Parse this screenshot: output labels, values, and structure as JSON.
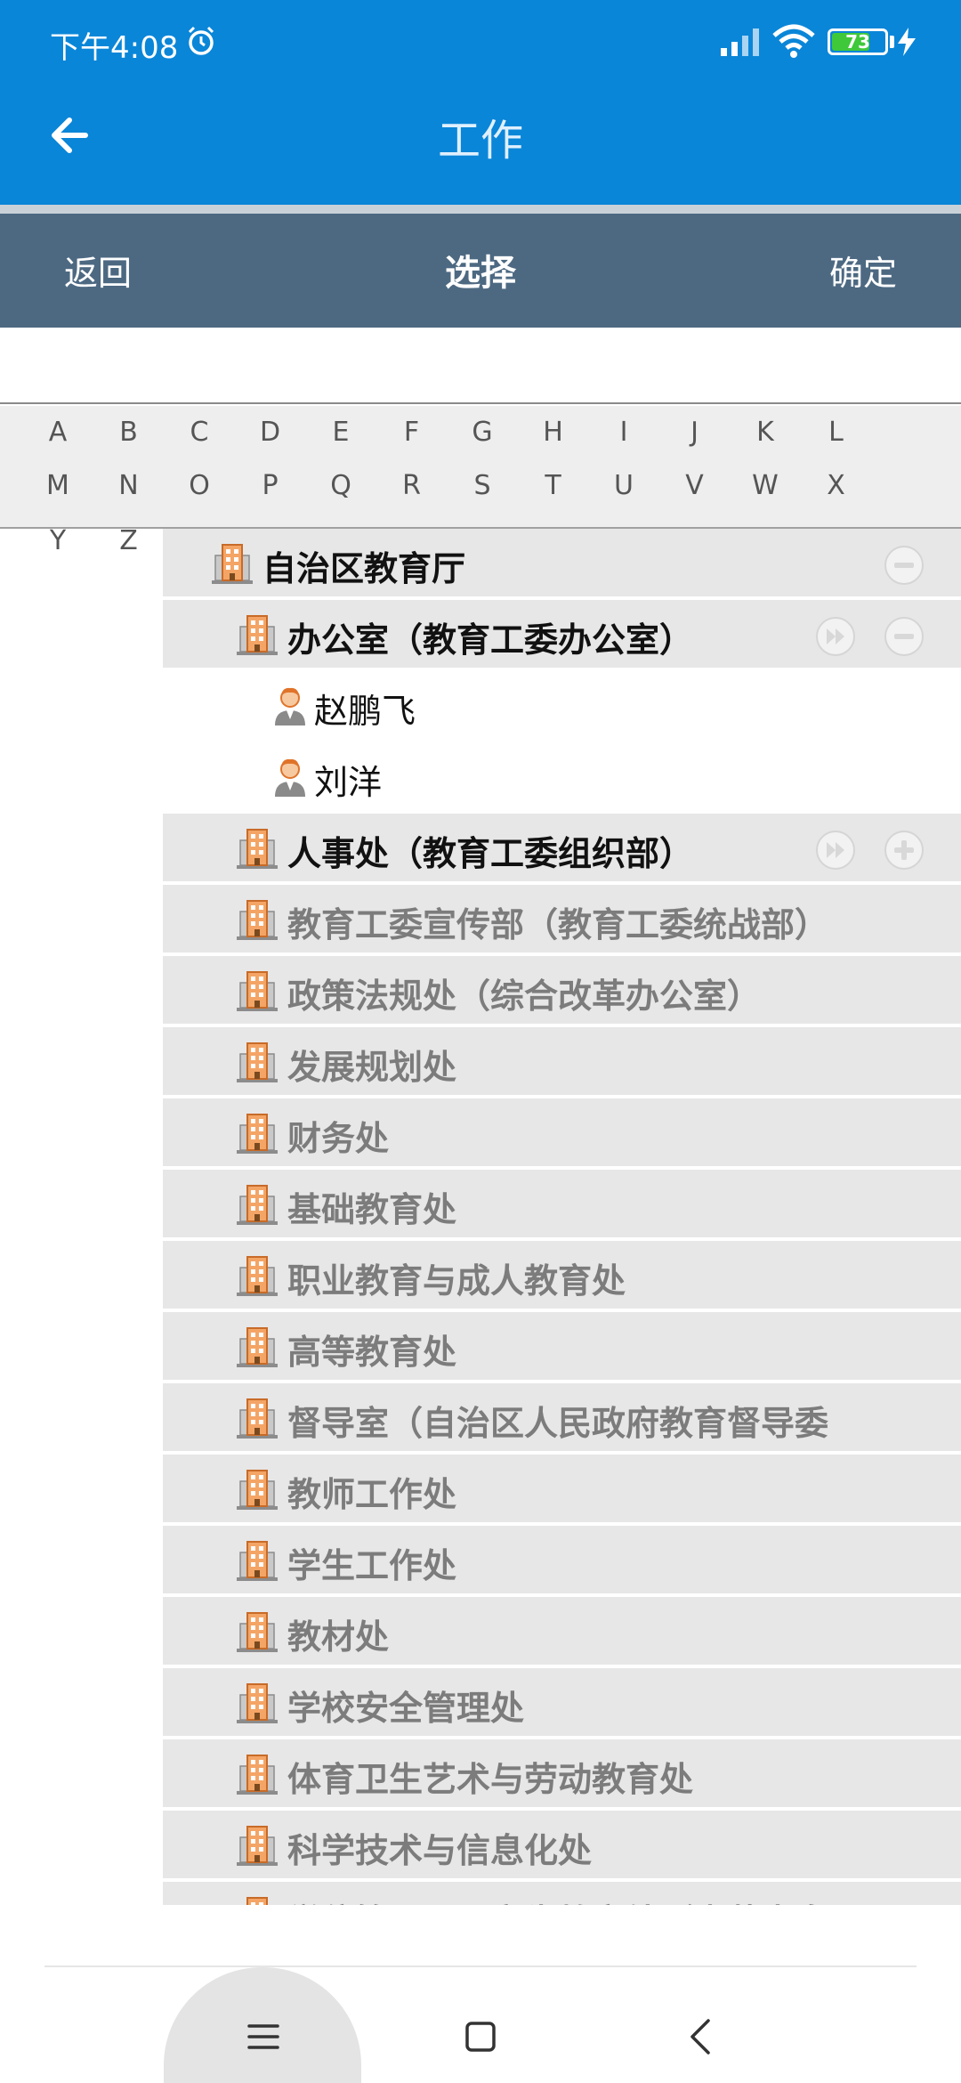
{
  "status_bar": {
    "time": "下午4:08",
    "battery_level": "73",
    "battery_fraction": 0.73
  },
  "header": {
    "title": "工作"
  },
  "select_bar": {
    "back_label": "返回",
    "title": "选择",
    "confirm_label": "确定"
  },
  "alphabet": [
    "A",
    "B",
    "C",
    "D",
    "E",
    "F",
    "G",
    "H",
    "I",
    "J",
    "K",
    "L",
    "M",
    "N",
    "O",
    "P",
    "Q",
    "R",
    "S",
    "T",
    "U",
    "V",
    "W",
    "X",
    "Y",
    "Z"
  ],
  "tree": [
    {
      "type": "org",
      "level": 1,
      "label": "自治区教育厅",
      "style": "bold",
      "expanded": true,
      "has_forward": false
    },
    {
      "type": "org",
      "level": 2,
      "label": "办公室（教育工委办公室）",
      "style": "bold",
      "expanded": true,
      "has_forward": true
    },
    {
      "type": "person",
      "level": 3,
      "label": "赵鹏飞"
    },
    {
      "type": "person",
      "level": 3,
      "label": "刘洋"
    },
    {
      "type": "org",
      "level": 2,
      "label": "人事处（教育工委组织部）",
      "style": "bold",
      "expanded": false,
      "has_forward": true
    },
    {
      "type": "org",
      "level": 2,
      "label": "教育工委宣传部（教育工委统战部）",
      "style": "muted"
    },
    {
      "type": "org",
      "level": 2,
      "label": "政策法规处（综合改革办公室）",
      "style": "muted"
    },
    {
      "type": "org",
      "level": 2,
      "label": "发展规划处",
      "style": "muted"
    },
    {
      "type": "org",
      "level": 2,
      "label": "财务处",
      "style": "muted"
    },
    {
      "type": "org",
      "level": 2,
      "label": "基础教育处",
      "style": "muted"
    },
    {
      "type": "org",
      "level": 2,
      "label": "职业教育与成人教育处",
      "style": "muted"
    },
    {
      "type": "org",
      "level": 2,
      "label": "高等教育处",
      "style": "muted"
    },
    {
      "type": "org",
      "level": 2,
      "label": "督导室（自治区人民政府教育督导委",
      "style": "muted"
    },
    {
      "type": "org",
      "level": 2,
      "label": "教师工作处",
      "style": "muted"
    },
    {
      "type": "org",
      "level": 2,
      "label": "学生工作处",
      "style": "muted"
    },
    {
      "type": "org",
      "level": 2,
      "label": "教材处",
      "style": "muted"
    },
    {
      "type": "org",
      "level": 2,
      "label": "学校安全管理处",
      "style": "muted"
    },
    {
      "type": "org",
      "level": 2,
      "label": "体育卫生艺术与劳动教育处",
      "style": "muted"
    },
    {
      "type": "org",
      "level": 2,
      "label": "科学技术与信息化处",
      "style": "muted"
    },
    {
      "type": "org",
      "level": 2,
      "label": "学位管理与研究生教育处（内蒙古自",
      "style": "muted"
    }
  ],
  "colors": {
    "header": "#0a86d8",
    "select_bar": "#4d6982",
    "row_bg": "#e7e7e7",
    "building": "#e8823a"
  },
  "icons": {
    "back": "back-arrow-icon",
    "alarm": "alarm-icon",
    "building": "building-icon",
    "person": "person-icon",
    "collapse": "minus-circle-icon",
    "expand": "plus-circle-icon",
    "forward": "fast-forward-icon"
  }
}
